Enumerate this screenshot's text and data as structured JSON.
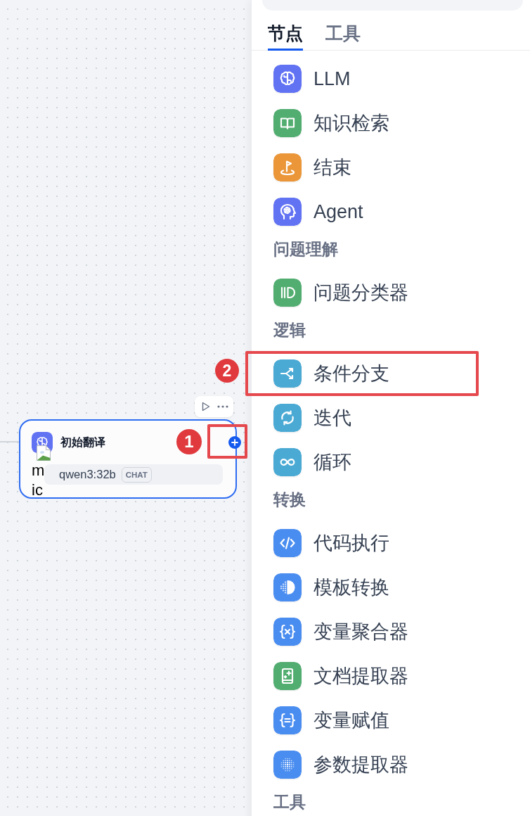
{
  "canvas": {
    "node": {
      "kind": "llm",
      "title": "初始翻译",
      "selected": true,
      "model": "qwen3:32b",
      "mode": "CHAT",
      "image_alt": "m ic",
      "annotation": "1"
    }
  },
  "panel": {
    "tabs": [
      {
        "label": "节点",
        "selected": true
      },
      {
        "label": "工具",
        "selected": false
      }
    ],
    "sections": [
      {
        "items": [
          {
            "kind": "llm",
            "label": "LLM",
            "color": "#6172f3"
          },
          {
            "kind": "knowledge",
            "label": "知识检索",
            "color": "#52ad70"
          },
          {
            "kind": "end",
            "label": "结束",
            "color": "#ea9639"
          },
          {
            "kind": "agent",
            "label": "Agent",
            "color": "#6172f3"
          }
        ]
      },
      {
        "title": "问题理解",
        "items": [
          {
            "kind": "classifier",
            "label": "问题分类器",
            "color": "#52ad70"
          }
        ]
      },
      {
        "title": "逻辑",
        "items": [
          {
            "kind": "ifelse",
            "label": "条件分支",
            "color": "#4aaad4",
            "annotation": "2"
          },
          {
            "kind": "iteration",
            "label": "迭代",
            "color": "#4aaad4"
          },
          {
            "kind": "loop",
            "label": "循环",
            "color": "#4aaad4"
          }
        ]
      },
      {
        "title": "转换",
        "items": [
          {
            "kind": "code",
            "label": "代码执行",
            "color": "#4a8df0"
          },
          {
            "kind": "template",
            "label": "模板转换",
            "color": "#4a8df0"
          },
          {
            "kind": "aggregator",
            "label": "变量聚合器",
            "color": "#4a8df0"
          },
          {
            "kind": "extractor",
            "label": "文档提取器",
            "color": "#52ad70"
          },
          {
            "kind": "assigner",
            "label": "变量赋值",
            "color": "#4a8df0"
          },
          {
            "kind": "parameter",
            "label": "参数提取器",
            "color": "#4a8df0"
          }
        ]
      },
      {
        "title": "工具"
      }
    ]
  }
}
